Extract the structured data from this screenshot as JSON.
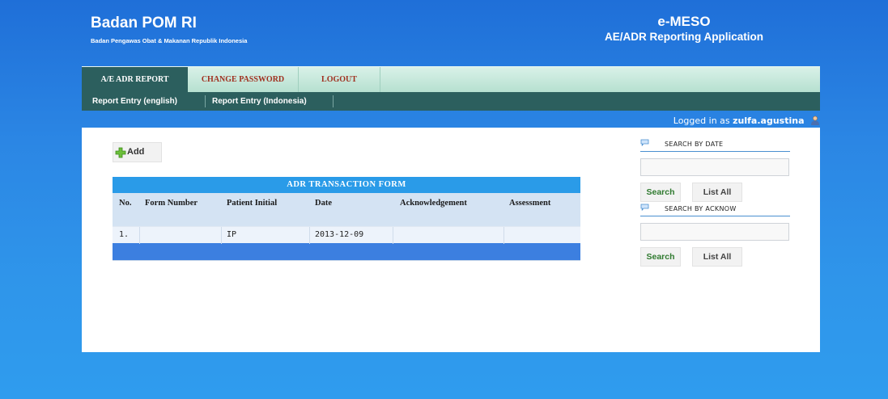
{
  "header": {
    "title": "Badan POM RI",
    "subtitle": "Badan Pengawas Obat & Makanan Republik Indonesia",
    "app_name": "e-MESO",
    "app_desc": "AE/ADR Reporting Application"
  },
  "nav": {
    "tabs": [
      {
        "label": "A/E ADR REPORT",
        "active": true
      },
      {
        "label": "CHANGE PASSWORD",
        "active": false
      },
      {
        "label": "LOGOUT",
        "active": false
      }
    ],
    "sub_links": [
      {
        "label": "Report Entry (english)"
      },
      {
        "label": "Report Entry (Indonesia)"
      }
    ]
  },
  "login": {
    "prefix": "Logged in as",
    "username": "zulfa.agustina"
  },
  "toolbar": {
    "add_label": "Add"
  },
  "grid": {
    "title": "ADR TRANSACTION FORM",
    "columns": [
      "No.",
      "Form Number",
      "Patient Initial",
      "Date",
      "Acknowledgement",
      "Assessment"
    ],
    "rows": [
      {
        "no": "1.",
        "form_number": "",
        "patient_initial": "IP",
        "date": "2013-12-09",
        "acknowledgement": "",
        "assessment": ""
      }
    ]
  },
  "search_date": {
    "label": "SEARCH BY DATE",
    "value": "",
    "search_label": "Search",
    "list_label": "List All"
  },
  "search_ack": {
    "label": "SEARCH BY ACKNOW",
    "value": "",
    "search_label": "Search",
    "list_label": "List All"
  },
  "colors": {
    "background": "#2b86e4",
    "nav_active": "#2c5f5e",
    "nav_inactive_text": "#a0301f",
    "grid_title": "#2a9be8",
    "grid_footer": "#3c7fe0",
    "search_text": "#2f7a2f"
  }
}
